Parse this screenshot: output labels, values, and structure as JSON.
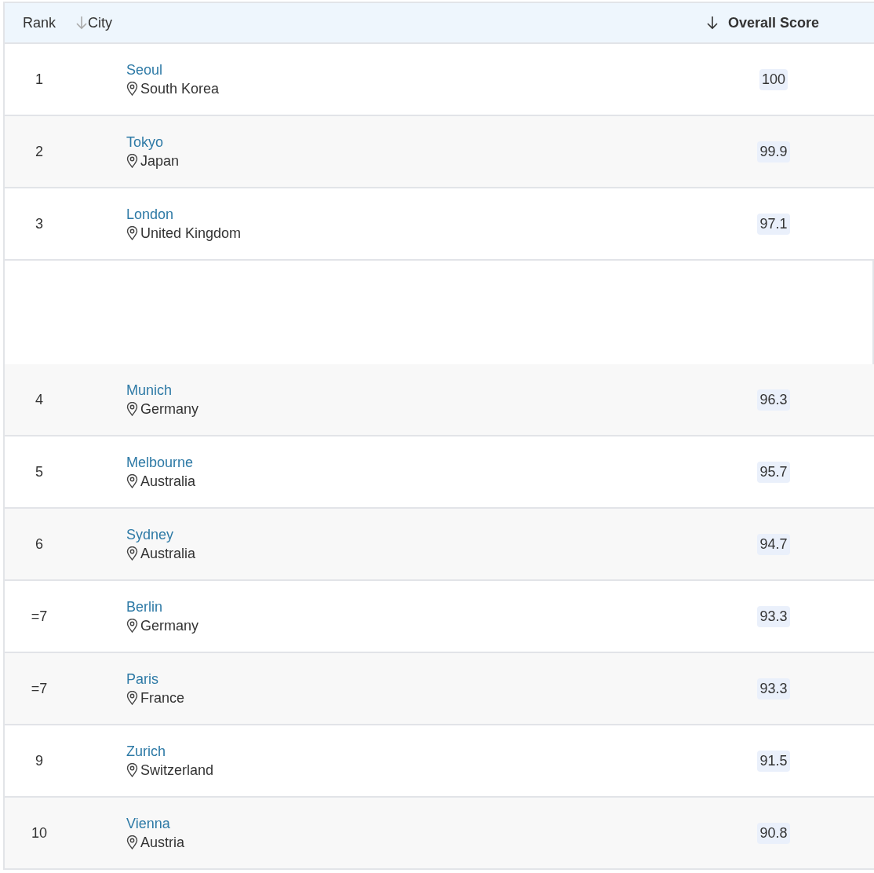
{
  "table": {
    "columns": [
      {
        "label": "Rank",
        "sorted": false,
        "sortable": false
      },
      {
        "label": "City",
        "sorted": false,
        "sortable": true
      },
      {
        "label": "Overall Score",
        "sorted": true,
        "sortable": true
      }
    ],
    "rows": [
      {
        "kind": "city",
        "rank": "1",
        "city": "Seoul",
        "country": "South Korea",
        "score": "100"
      },
      {
        "kind": "city",
        "rank": "2",
        "city": "Tokyo",
        "country": "Japan",
        "score": "99.9"
      },
      {
        "kind": "city",
        "rank": "3",
        "city": "London",
        "country": "United Kingdom",
        "score": "97.1"
      },
      {
        "kind": "spacer"
      },
      {
        "kind": "city",
        "rank": "4",
        "city": "Munich",
        "country": "Germany",
        "score": "96.3"
      },
      {
        "kind": "city",
        "rank": "5",
        "city": "Melbourne",
        "country": "Australia",
        "score": "95.7"
      },
      {
        "kind": "city",
        "rank": "6",
        "city": "Sydney",
        "country": "Australia",
        "score": "94.7"
      },
      {
        "kind": "city",
        "rank": "=7",
        "city": "Berlin",
        "country": "Germany",
        "score": "93.3"
      },
      {
        "kind": "city",
        "rank": "=7",
        "city": "Paris",
        "country": "France",
        "score": "93.3"
      },
      {
        "kind": "city",
        "rank": "9",
        "city": "Zurich",
        "country": "Switzerland",
        "score": "91.5"
      },
      {
        "kind": "city",
        "rank": "10",
        "city": "Vienna",
        "country": "Austria",
        "score": "90.8"
      }
    ]
  }
}
